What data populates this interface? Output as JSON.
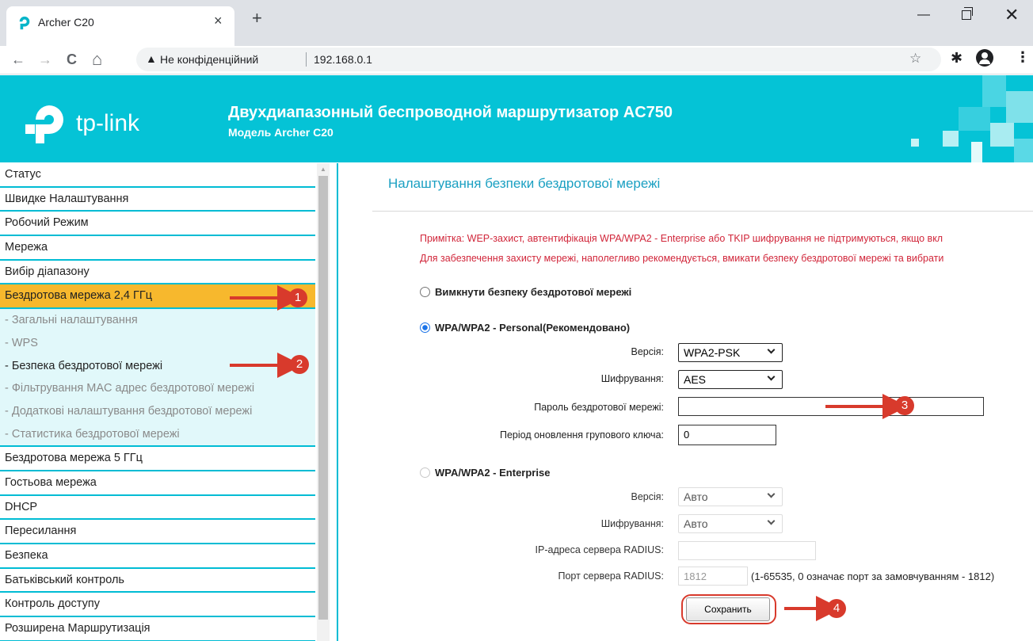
{
  "browser": {
    "tab_title": "Archer C20",
    "tab_close": "×",
    "new_tab": "+",
    "nav_back": "←",
    "nav_forward": "→",
    "nav_reload": "C",
    "nav_home": "⌂",
    "security_warning_icon": "▲",
    "security_label": "Не конфіденційний",
    "url": "192.168.0.1",
    "star": "☆",
    "extension": "✱",
    "menu": "⋮",
    "win_min": "—",
    "win_close": "✕"
  },
  "header": {
    "logo_text": "tp-link",
    "title": "Двухдиапазонный беспроводной маршрутизатор AC750",
    "model": "Модель Archer C20",
    "brand_color": "#05c3d6"
  },
  "sidebar": {
    "items_before": [
      "Статус",
      "Швидке Налаштування",
      "Робочий Режим",
      "Мережа",
      "Вибір діапазону"
    ],
    "active_item": "Бездротова мережа 2,4 ГГц",
    "sub_items": [
      "- Загальні налаштування",
      "- WPS",
      "- Безпека бездротової мережі",
      "- Фільтрування MAC адрес бездротової мережі",
      "- Додаткові налаштування бездротової мережі",
      "- Статистика бездротової мережі"
    ],
    "current_sub_index": 2,
    "items_after": [
      "Бездротова мережа 5 ГГц",
      "Гостьова мережа",
      "DHCP",
      "Пересилання",
      "Безпека",
      "Батьківський контроль",
      "Контроль доступу",
      "Розширена Маршрутизація"
    ]
  },
  "content": {
    "title": "Налаштування безпеки бездротової мережі",
    "note_line1": "Примітка: WEP-захист, автентифікація WPA/WPA2 - Enterprise або TKIP шифрування не підтримуються, якщо вкл",
    "note_line2": "Для забезпечення захисту мережі, наполегливо рекомендується, вмикати безпеку бездротової мережі та вибрати",
    "disable_option": "Вимкнути безпеку бездротової мережі",
    "personal": {
      "label": "WPA/WPA2 - Personal(Рекомендовано)",
      "version_label": "Версія:",
      "version_value": "WPA2-PSK",
      "encryption_label": "Шифрування:",
      "encryption_value": "AES",
      "password_label": "Пароль бездротової мережі:",
      "password_value": "",
      "group_key_label": "Період оновлення групового ключа:",
      "group_key_value": "0"
    },
    "enterprise": {
      "label": "WPA/WPA2 - Enterprise",
      "version_label": "Версія:",
      "version_value": "Авто",
      "encryption_label": "Шифрування:",
      "encryption_value": "Авто",
      "radius_ip_label": "IP-адреса сервера RADIUS:",
      "radius_ip_value": "",
      "radius_port_label": "Порт сервера RADIUS:",
      "radius_port_value": "1812",
      "radius_port_hint": "(1-65535, 0 означає порт за замовчуванням - 1812)"
    },
    "save_label": "Сохранить"
  },
  "annotations": {
    "badges": [
      "1",
      "2",
      "3",
      "4"
    ],
    "color": "#d83a2c"
  }
}
